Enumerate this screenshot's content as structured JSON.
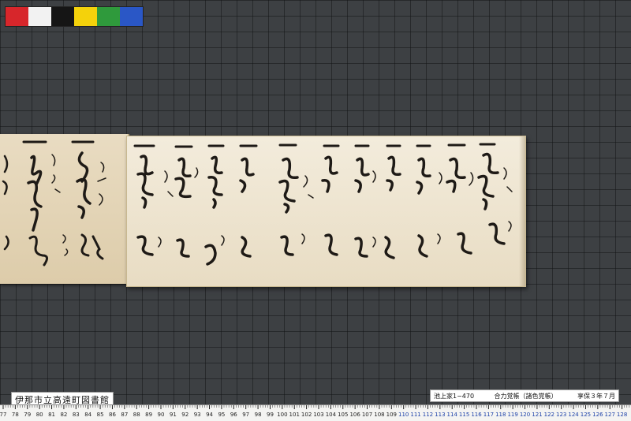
{
  "color_chart": {
    "swatches": [
      "#d7262b",
      "#f2f2f2",
      "#151515",
      "#f4d20b",
      "#2f9a3c",
      "#2a57c6"
    ]
  },
  "library_label": "伊那市立高遠町図書館",
  "catalog_label": {
    "collection_number": "池上家1−470",
    "title": "合力覚帳（諸色覚帳）",
    "date": "享保３年７月"
  },
  "ruler": {
    "start": 77,
    "end": 128
  }
}
